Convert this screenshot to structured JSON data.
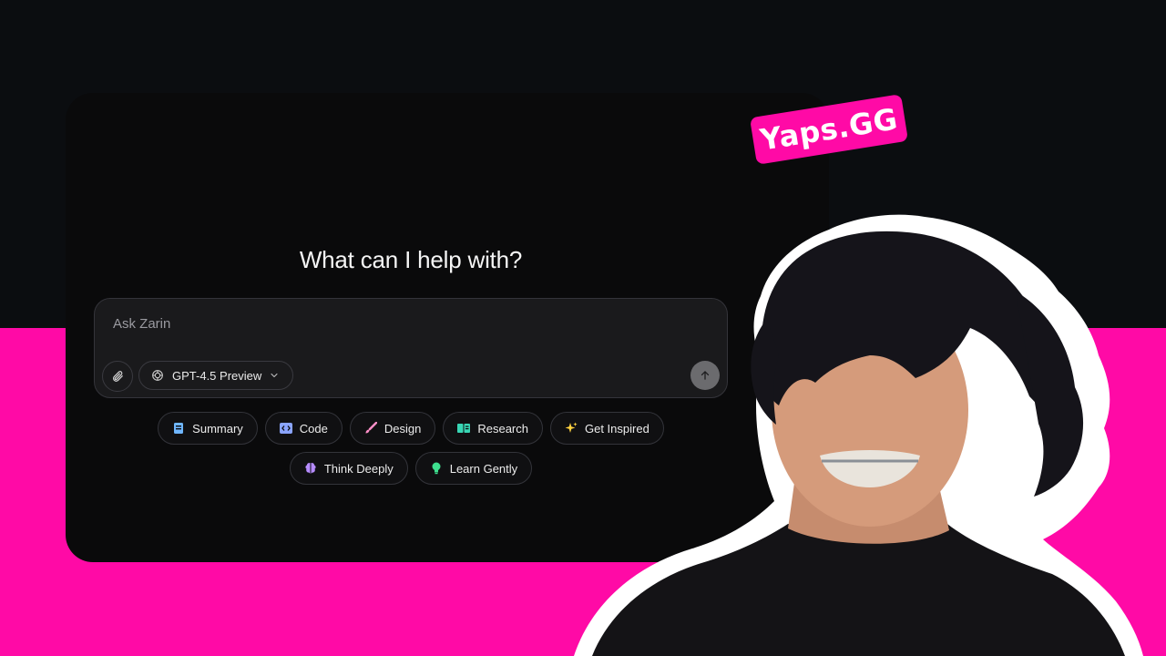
{
  "headline": "What can I help with?",
  "composer": {
    "placeholder": "Ask Zarin",
    "model_label": "GPT-4.5 Preview",
    "attach_icon": "paperclip-icon",
    "send_icon": "arrow-up-icon"
  },
  "chips_row1": [
    {
      "label": "Summary",
      "icon": "notepad-icon",
      "color": "#6fb6ff"
    },
    {
      "label": "Code",
      "icon": "code-icon",
      "color": "#8aa4ff"
    },
    {
      "label": "Design",
      "icon": "brush-icon",
      "color": "#ff8fc8"
    },
    {
      "label": "Research",
      "icon": "book-icon",
      "color": "#38d6b4"
    },
    {
      "label": "Get Inspired",
      "icon": "sparkle-icon",
      "color": "#ffd23f"
    }
  ],
  "chips_row2": [
    {
      "label": "Think Deeply",
      "icon": "brain-icon",
      "color": "#b68cff"
    },
    {
      "label": "Learn Gently",
      "icon": "lightbulb-icon",
      "color": "#3ee08f"
    }
  ],
  "brand": {
    "text": "Yaps.GG",
    "color": "#ff0aa6"
  },
  "colors": {
    "accent_pink": "#ff0aa6",
    "card": "#0a0a0b",
    "bg": "#0b0d10"
  }
}
